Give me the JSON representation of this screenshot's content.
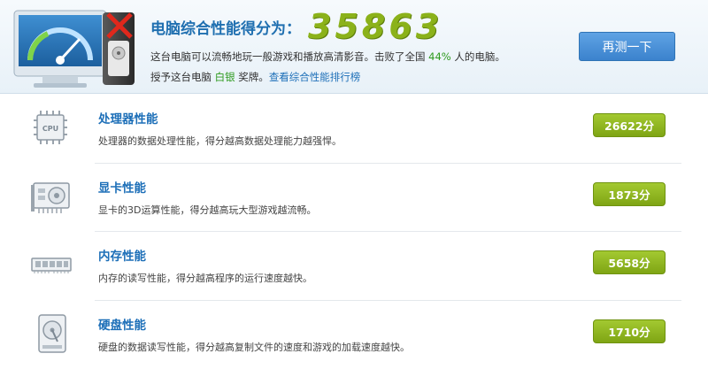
{
  "header": {
    "score_label": "电脑综合性能得分为：",
    "score_value": "35863",
    "desc_before": "这台电脑可以流畅地玩一般游戏和播放高清影音。击败了全国 ",
    "desc_percent": "44%",
    "desc_after": " 人的电脑。",
    "award_before": "授予这台电脑 ",
    "award_medal": "白银",
    "award_after": " 奖牌。",
    "ranking_link": "查看综合性能排行榜",
    "retest_button": "再测一下"
  },
  "items": [
    {
      "title": "处理器性能",
      "desc": "处理器的数据处理性能，得分越高数据处理能力越强悍。",
      "score": "26622分",
      "icon": "cpu-icon",
      "icon_text": "CPU"
    },
    {
      "title": "显卡性能",
      "desc": "显卡的3D运算性能，得分越高玩大型游戏越流畅。",
      "score": "1873分",
      "icon": "graphics-card-icon"
    },
    {
      "title": "内存性能",
      "desc": "内存的读写性能，得分越高程序的运行速度越快。",
      "score": "5658分",
      "icon": "memory-icon"
    },
    {
      "title": "硬盘性能",
      "desc": "硬盘的数据读写性能，得分越高复制文件的速度和游戏的加载速度越快。",
      "score": "1710分",
      "icon": "hard-disk-icon"
    }
  ],
  "colors": {
    "title_blue": "#1d6fb8",
    "score_green": "#8bb21a",
    "badge_green": "#8ab520",
    "button_blue": "#4a90d9"
  }
}
